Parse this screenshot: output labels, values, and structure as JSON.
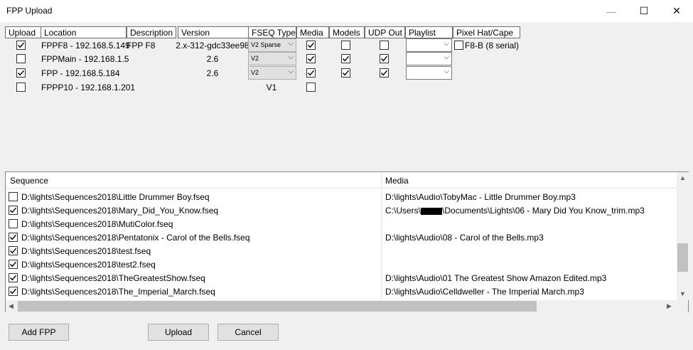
{
  "window": {
    "title": "FPP Upload"
  },
  "fpp_table": {
    "columns": [
      "Upload",
      "Location",
      "Description",
      "Version",
      "FSEQ Type",
      "Media",
      "Models",
      "UDP Out",
      "Playlist",
      "Pixel Hat/Cape"
    ],
    "rows": [
      {
        "upload": true,
        "location": "FPPF8 - 192.168.5.149",
        "description": "FPP F8",
        "version": "2.x-312-gdc33ee98",
        "fseq": "V2 Sparse",
        "media": true,
        "models": false,
        "udp": false,
        "playlist": "",
        "pixel_checked": false,
        "pixel_label": "F8-B (8 serial)"
      },
      {
        "upload": false,
        "location": "FPPMain - 192.168.1.5",
        "description": "",
        "version": "2.6",
        "fseq": "V2",
        "media": true,
        "models": true,
        "udp": true,
        "playlist": ""
      },
      {
        "upload": true,
        "location": "FPP - 192.168.5.184",
        "description": "",
        "version": "2.6",
        "fseq": "V2",
        "media": true,
        "models": true,
        "udp": true,
        "playlist": ""
      },
      {
        "upload": false,
        "location": "FPPP10 - 192.168.1.201",
        "description": "",
        "version": "",
        "fseq": "V1",
        "media": false
      }
    ]
  },
  "sequence_grid": {
    "headers": {
      "sequence": "Sequence",
      "media": "Media"
    },
    "rows": [
      {
        "checked": false,
        "sequence": "D:\\lights\\Sequences2018\\Little Drummer Boy.fseq",
        "media": "D:\\lights\\Audio\\TobyMac - Little Drummer Boy.mp3"
      },
      {
        "checked": true,
        "sequence": "D:\\lights\\Sequences2018\\Mary_Did_You_Know.fseq",
        "media_prefix": "C:\\Users\\",
        "media": "\\Documents\\Lights\\06 - Mary Did You Know_trim.mp3",
        "redacted": true
      },
      {
        "checked": false,
        "sequence": "D:\\lights\\Sequences2018\\MutiColor.fseq",
        "media": ""
      },
      {
        "checked": true,
        "sequence": "D:\\lights\\Sequences2018\\Pentatonix - Carol of the Bells.fseq",
        "media": "D:\\lights\\Audio\\08 - Carol of the Bells.mp3"
      },
      {
        "checked": true,
        "sequence": "D:\\lights\\Sequences2018\\test.fseq",
        "media": ""
      },
      {
        "checked": true,
        "sequence": "D:\\lights\\Sequences2018\\test2.fseq",
        "media": ""
      },
      {
        "checked": true,
        "sequence": "D:\\lights\\Sequences2018\\TheGreatestShow.fseq",
        "media": "D:\\lights\\Audio\\01 The Greatest Show Amazon Edited.mp3"
      },
      {
        "checked": true,
        "sequence": "D:\\lights\\Sequences2018\\The_Imperial_March.fseq",
        "media": "D:\\lights\\Audio\\Celldweller - The Imperial March.mp3"
      }
    ]
  },
  "buttons": {
    "add_fpp": "Add FPP",
    "upload": "Upload",
    "cancel": "Cancel"
  },
  "icons": {
    "minimize": "minimize-icon",
    "maximize": "maximize-icon",
    "close": "close-icon",
    "dropdown": "chevron-down-icon",
    "check": "checkmark-icon"
  },
  "colors": {
    "window_bg": "#f0f0f0",
    "grid_bg": "#ffffff",
    "button_bg": "#e1e1e1",
    "scroll_thumb": "#c1c1c1"
  }
}
